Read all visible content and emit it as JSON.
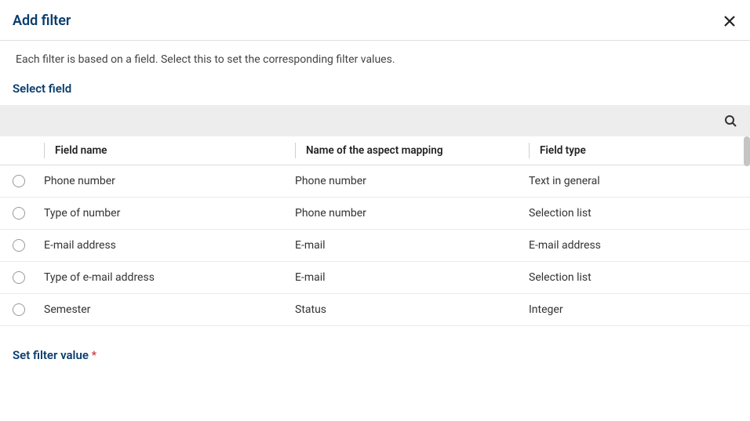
{
  "dialog": {
    "title": "Add filter",
    "description": "Each filter is based on a field. Select this to set the corresponding filter values."
  },
  "sections": {
    "select_field": "Select field",
    "set_filter_value": "Set filter value"
  },
  "required_marker": "*",
  "table": {
    "headers": {
      "field_name": "Field name",
      "aspect_mapping": "Name of the aspect mapping",
      "field_type": "Field type"
    },
    "rows": [
      {
        "field_name": "Phone number",
        "aspect_mapping": "Phone number",
        "field_type": "Text in general"
      },
      {
        "field_name": "Type of number",
        "aspect_mapping": "Phone number",
        "field_type": "Selection list"
      },
      {
        "field_name": "E-mail address",
        "aspect_mapping": "E-mail",
        "field_type": "E-mail address"
      },
      {
        "field_name": "Type of e-mail address",
        "aspect_mapping": "E-mail",
        "field_type": "Selection list"
      },
      {
        "field_name": "Semester",
        "aspect_mapping": "Status",
        "field_type": "Integer"
      }
    ]
  }
}
